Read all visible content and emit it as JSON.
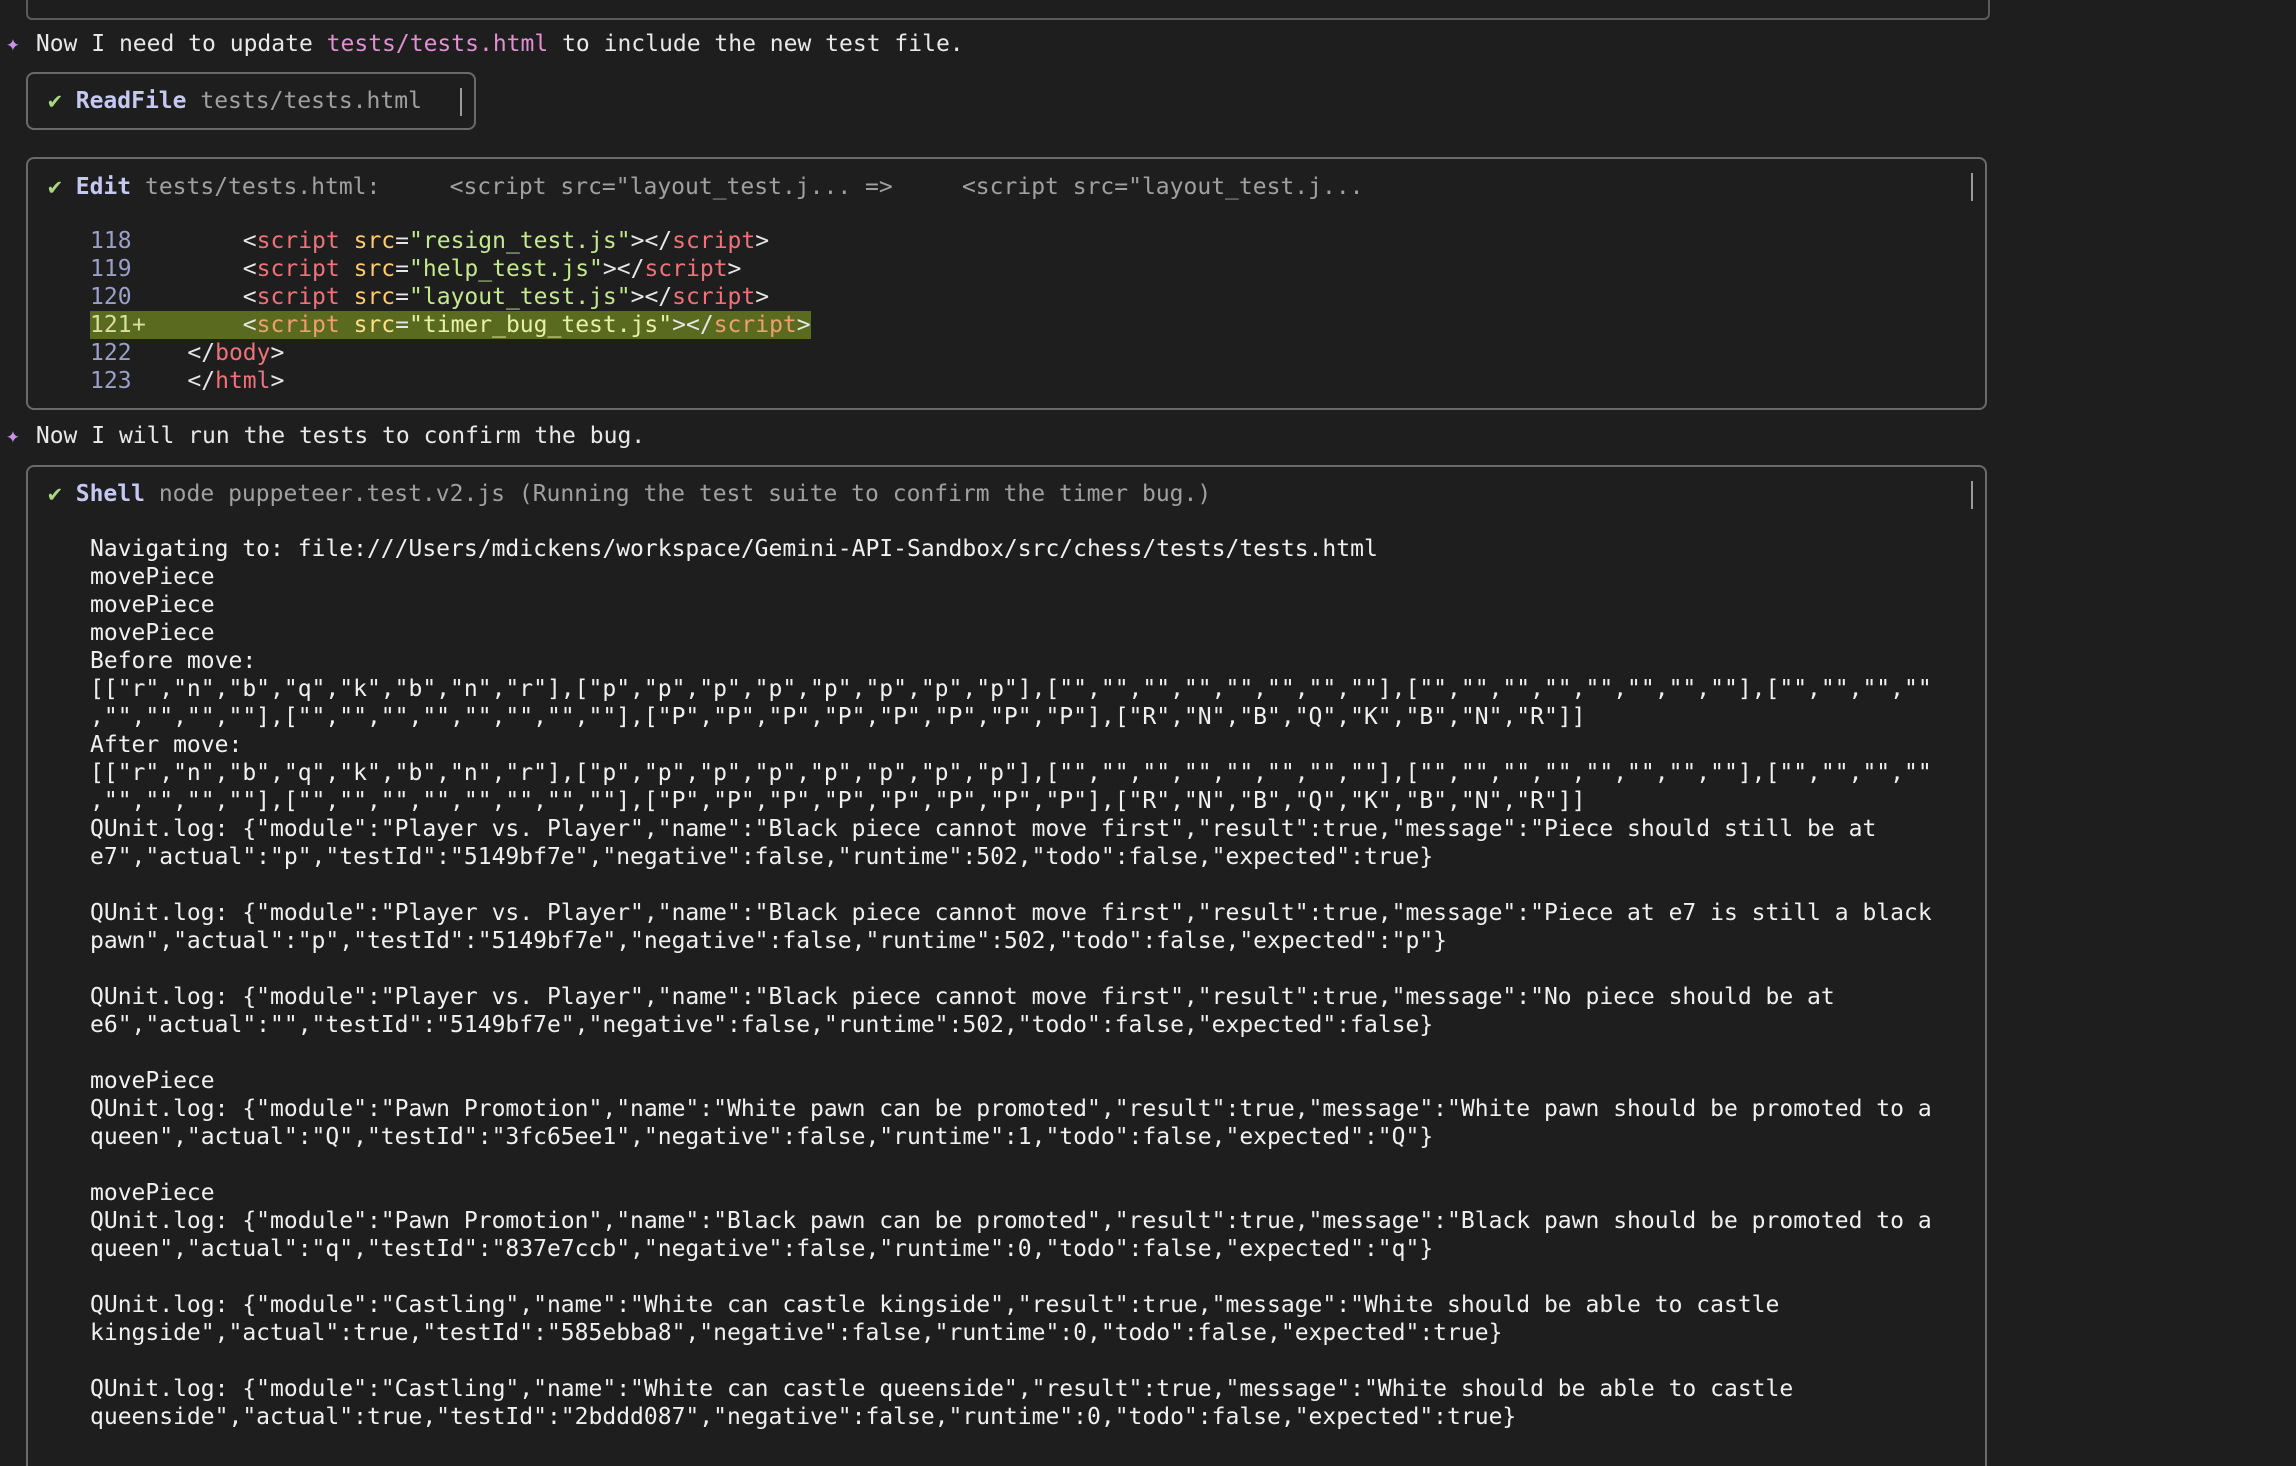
{
  "messages": {
    "update": {
      "prefix": "Now I need to update ",
      "path": "tests/tests.html",
      "suffix": " to include the new test file."
    },
    "run": "Now I will run the tests to confirm the bug."
  },
  "sparkle_glyph": "✦",
  "check_glyph": "✔",
  "readfile": {
    "tool": "ReadFile",
    "desc": "tests/tests.html"
  },
  "edit": {
    "tool": "Edit",
    "desc": "tests/tests.html:     <script src=\"layout_test.j... =>     <script src=\"layout_test.j...",
    "lines": [
      {
        "num": "118",
        "marker": " ",
        "indent": "    ",
        "file": "resign_test.js",
        "added": false
      },
      {
        "num": "119",
        "marker": " ",
        "indent": "    ",
        "file": "help_test.js",
        "added": false
      },
      {
        "num": "120",
        "marker": " ",
        "indent": "    ",
        "file": "layout_test.js",
        "added": false
      },
      {
        "num": "121",
        "marker": "+",
        "indent": "    ",
        "file": "timer_bug_test.js",
        "added": true
      }
    ],
    "closing": [
      {
        "num": "122",
        "text": "</body>",
        "tag": "body"
      },
      {
        "num": "123",
        "text": "</html>",
        "tag": "html"
      }
    ]
  },
  "shell": {
    "tool": "Shell",
    "desc": "node puppeteer.test.v2.js (Running the test suite to confirm the timer bug.)",
    "output": [
      "Navigating to: file:///Users/mdickens/workspace/Gemini-API-Sandbox/src/chess/tests/tests.html",
      "movePiece",
      "movePiece",
      "movePiece",
      "Before move:",
      "[[\"r\",\"n\",\"b\",\"q\",\"k\",\"b\",\"n\",\"r\"],[\"p\",\"p\",\"p\",\"p\",\"p\",\"p\",\"p\",\"p\"],[\"\",\"\",\"\",\"\",\"\",\"\",\"\",\"\"],[\"\",\"\",\"\",\"\",\"\",\"\",\"\",\"\"],[\"\",\"\",\"\",\"\"",
      ",\"\",\"\",\"\",\"\"],[\"\",\"\",\"\",\"\",\"\",\"\",\"\",\"\"],[\"P\",\"P\",\"P\",\"P\",\"P\",\"P\",\"P\",\"P\"],[\"R\",\"N\",\"B\",\"Q\",\"K\",\"B\",\"N\",\"R\"]]",
      "After move:",
      "[[\"r\",\"n\",\"b\",\"q\",\"k\",\"b\",\"n\",\"r\"],[\"p\",\"p\",\"p\",\"p\",\"p\",\"p\",\"p\",\"p\"],[\"\",\"\",\"\",\"\",\"\",\"\",\"\",\"\"],[\"\",\"\",\"\",\"\",\"\",\"\",\"\",\"\"],[\"\",\"\",\"\",\"\"",
      ",\"\",\"\",\"\",\"\"],[\"\",\"\",\"\",\"\",\"\",\"\",\"\",\"\"],[\"P\",\"P\",\"P\",\"P\",\"P\",\"P\",\"P\",\"P\"],[\"R\",\"N\",\"B\",\"Q\",\"K\",\"B\",\"N\",\"R\"]]",
      "QUnit.log: {\"module\":\"Player vs. Player\",\"name\":\"Black piece cannot move first\",\"result\":true,\"message\":\"Piece should still be at",
      "e7\",\"actual\":\"p\",\"testId\":\"5149bf7e\",\"negative\":false,\"runtime\":502,\"todo\":false,\"expected\":true}",
      "",
      "QUnit.log: {\"module\":\"Player vs. Player\",\"name\":\"Black piece cannot move first\",\"result\":true,\"message\":\"Piece at e7 is still a black",
      "pawn\",\"actual\":\"p\",\"testId\":\"5149bf7e\",\"negative\":false,\"runtime\":502,\"todo\":false,\"expected\":\"p\"}",
      "",
      "QUnit.log: {\"module\":\"Player vs. Player\",\"name\":\"Black piece cannot move first\",\"result\":true,\"message\":\"No piece should be at",
      "e6\",\"actual\":\"\",\"testId\":\"5149bf7e\",\"negative\":false,\"runtime\":502,\"todo\":false,\"expected\":false}",
      "",
      "movePiece",
      "QUnit.log: {\"module\":\"Pawn Promotion\",\"name\":\"White pawn can be promoted\",\"result\":true,\"message\":\"White pawn should be promoted to a",
      "queen\",\"actual\":\"Q\",\"testId\":\"3fc65ee1\",\"negative\":false,\"runtime\":1,\"todo\":false,\"expected\":\"Q\"}",
      "",
      "movePiece",
      "QUnit.log: {\"module\":\"Pawn Promotion\",\"name\":\"Black pawn can be promoted\",\"result\":true,\"message\":\"Black pawn should be promoted to a",
      "queen\",\"actual\":\"q\",\"testId\":\"837e7ccb\",\"negative\":false,\"runtime\":0,\"todo\":false,\"expected\":\"q\"}",
      "",
      "QUnit.log: {\"module\":\"Castling\",\"name\":\"White can castle kingside\",\"result\":true,\"message\":\"White should be able to castle",
      "kingside\",\"actual\":true,\"testId\":\"585ebba8\",\"negative\":false,\"runtime\":0,\"todo\":false,\"expected\":true}",
      "",
      "QUnit.log: {\"module\":\"Castling\",\"name\":\"White can castle queenside\",\"result\":true,\"message\":\"White should be able to castle",
      "queenside\",\"actual\":true,\"testId\":\"2bddd087\",\"negative\":false,\"runtime\":0,\"todo\":false,\"expected\":true}"
    ]
  }
}
